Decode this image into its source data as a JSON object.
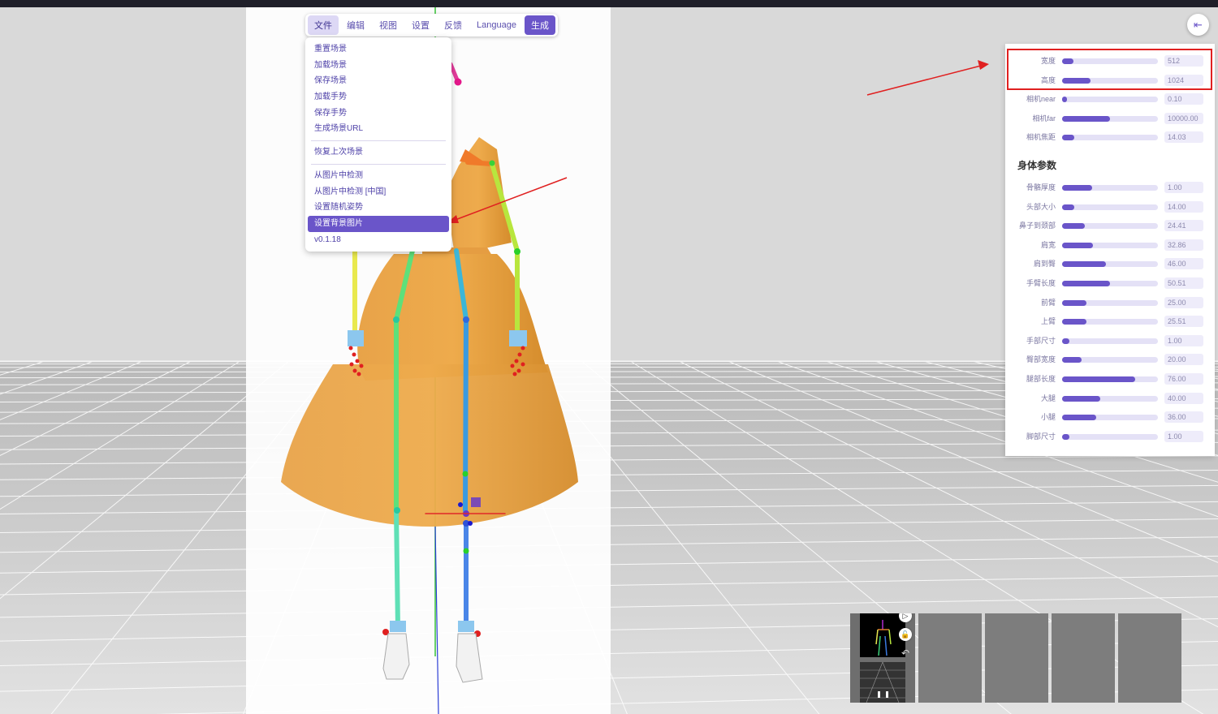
{
  "menubar": {
    "items": [
      "文件",
      "编辑",
      "视图",
      "设置",
      "反馈",
      "Language"
    ],
    "generate_label": "生成"
  },
  "file_menu": {
    "group1": [
      "重置场景",
      "加载场景",
      "保存场景",
      "加载手势",
      "保存手势",
      "生成场景URL"
    ],
    "group2": [
      "恢复上次场景"
    ],
    "group3": [
      "从图片中检测",
      "从图片中检测 [中国]",
      "设置随机姿势",
      "设置背景图片"
    ],
    "selected_item": "设置背景图片",
    "version": "v0.1.18"
  },
  "panel": {
    "collapse_icon": "⇤",
    "camera_params": [
      {
        "label": "宽度",
        "value": "512",
        "fraction": 0.12
      },
      {
        "label": "高度",
        "value": "1024",
        "fraction": 0.3
      },
      {
        "label": "相机near",
        "value": "0.10",
        "fraction": 0.05
      },
      {
        "label": "相机far",
        "value": "10000.00",
        "fraction": 0.5
      },
      {
        "label": "相机焦距",
        "value": "14.03",
        "fraction": 0.13
      }
    ],
    "body_section_title": "身体参数",
    "body_params": [
      {
        "label": "骨骼厚度",
        "value": "1.00",
        "fraction": 0.31
      },
      {
        "label": "头部大小",
        "value": "14.00",
        "fraction": 0.13
      },
      {
        "label": "鼻子到颈部",
        "value": "24.41",
        "fraction": 0.24
      },
      {
        "label": "肩宽",
        "value": "32.86",
        "fraction": 0.32
      },
      {
        "label": "肩到臀",
        "value": "46.00",
        "fraction": 0.46
      },
      {
        "label": "手臂长度",
        "value": "50.51",
        "fraction": 0.5
      },
      {
        "label": "前臂",
        "value": "25.00",
        "fraction": 0.25
      },
      {
        "label": "上臂",
        "value": "25.51",
        "fraction": 0.25
      },
      {
        "label": "手部尺寸",
        "value": "1.00",
        "fraction": 0.08
      },
      {
        "label": "臀部宽度",
        "value": "20.00",
        "fraction": 0.2
      },
      {
        "label": "腿部长度",
        "value": "76.00",
        "fraction": 0.76
      },
      {
        "label": "大腿",
        "value": "40.00",
        "fraction": 0.4
      },
      {
        "label": "小腿",
        "value": "36.00",
        "fraction": 0.36
      },
      {
        "label": "脚部尺寸",
        "value": "1.00",
        "fraction": 0.08
      }
    ]
  },
  "thumbnail_controls": {
    "play_icon": "▷",
    "lock_icon": "🔓",
    "undo_icon": "↶"
  },
  "colors": {
    "accent": "#6a55c9",
    "annotation": "#e02020",
    "dress": "#e39a3a"
  }
}
